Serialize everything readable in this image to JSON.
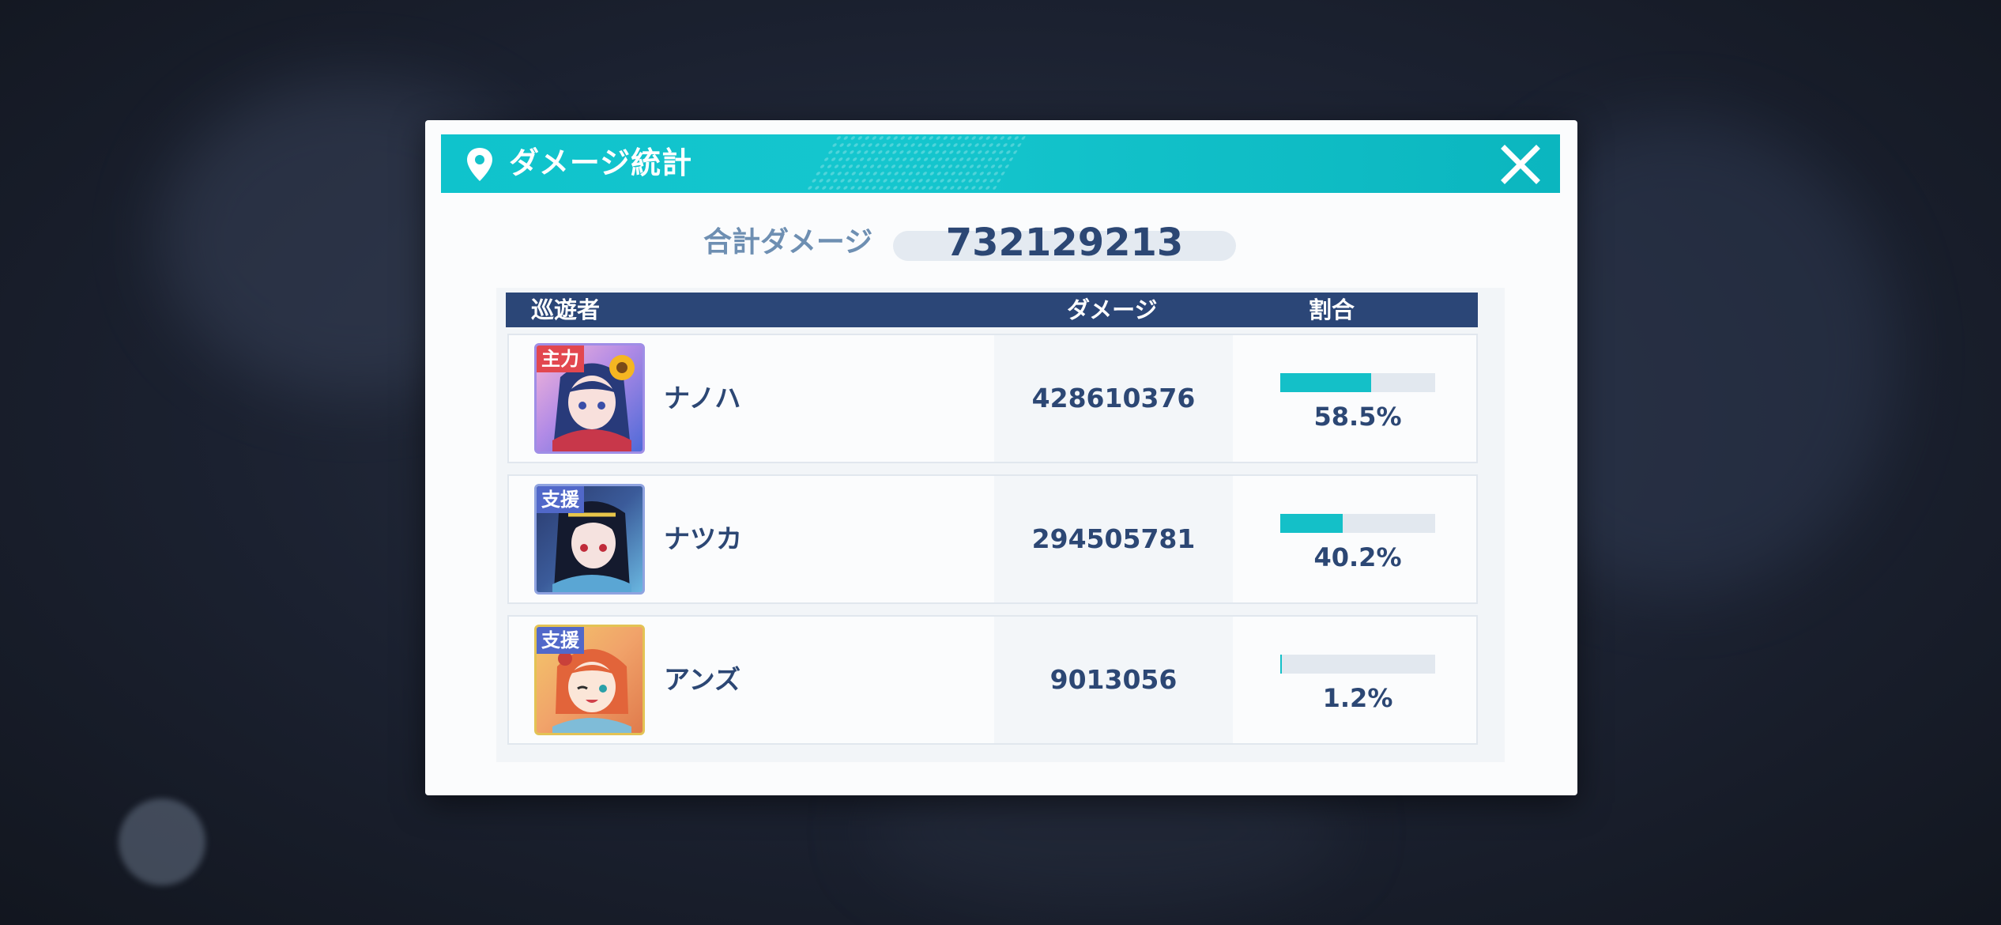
{
  "dialog": {
    "title": "ダメージ統計",
    "icons": {
      "header": "map-pin-icon",
      "close": "close-icon"
    }
  },
  "total": {
    "label": "合計ダメージ",
    "value": "732129213"
  },
  "table": {
    "headers": {
      "player": "巡遊者",
      "damage": "ダメージ",
      "ratio": "割合"
    },
    "rows": [
      {
        "role": "主力",
        "name": "ナノハ",
        "damage": "428610376",
        "ratio_text": "58.5%",
        "ratio": 0.585
      },
      {
        "role": "支援",
        "name": "ナツカ",
        "damage": "294505781",
        "ratio_text": "40.2%",
        "ratio": 0.402
      },
      {
        "role": "支援",
        "name": "アンズ",
        "damage": "9013056",
        "ratio_text": "1.2%",
        "ratio": 0.012
      }
    ]
  },
  "colors": {
    "header_bg": "#15c6ce",
    "table_head_bg": "#2b4677",
    "text_dark": "#2c4774",
    "bar_fill": "#14c0c8",
    "badge_main": "#e2474f",
    "badge_support": "#5168c9"
  }
}
